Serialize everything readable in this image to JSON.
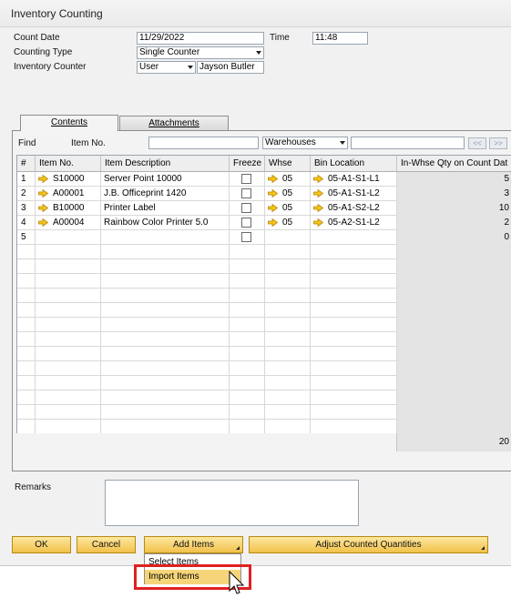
{
  "window": {
    "title": "Inventory Counting"
  },
  "header": {
    "count_date_label": "Count Date",
    "count_date_value": "11/29/2022",
    "time_label": "Time",
    "time_value": "11:48",
    "counting_type_label": "Counting Type",
    "counting_type_value": "Single Counter",
    "inventory_counter_label": "Inventory Counter",
    "inventory_counter_type": "User",
    "inventory_counter_name": "Jayson Butler"
  },
  "tabs": [
    {
      "label": "Contents",
      "active": true
    },
    {
      "label": "Attachments",
      "active": false
    }
  ],
  "find": {
    "label": "Find",
    "item_no_label": "Item No.",
    "item_no_value": "",
    "warehouses_value": "Warehouses",
    "warehouse_input_value": "",
    "prev_label": "<<",
    "next_label": ">>"
  },
  "grid": {
    "columns": [
      "#",
      "Item No.",
      "Item Description",
      "Freeze",
      "Whse",
      "Bin Location",
      "In-Whse Qty on Count Dat"
    ],
    "rows": [
      {
        "num": "1",
        "item_no": "S10000",
        "description": "Server Point 10000",
        "freeze": false,
        "whse": "05",
        "bin": "05-A1-S1-L1",
        "qty": "5"
      },
      {
        "num": "2",
        "item_no": "A00001",
        "description": "J.B. Officeprint 1420",
        "freeze": false,
        "whse": "05",
        "bin": "05-A1-S1-L2",
        "qty": "3"
      },
      {
        "num": "3",
        "item_no": "B10000",
        "description": "Printer Label",
        "freeze": false,
        "whse": "05",
        "bin": "05-A1-S2-L2",
        "qty": "10"
      },
      {
        "num": "4",
        "item_no": "A00004",
        "description": "Rainbow Color Printer 5.0",
        "freeze": false,
        "whse": "05",
        "bin": "05-A2-S1-L2",
        "qty": "2"
      },
      {
        "num": "5",
        "item_no": "",
        "description": "",
        "freeze": false,
        "whse": "",
        "bin": "",
        "qty": "0"
      }
    ],
    "total_qty": "20"
  },
  "remarks": {
    "label": "Remarks",
    "value": ""
  },
  "buttons": {
    "ok": "OK",
    "cancel": "Cancel",
    "add_items": "Add Items",
    "adjust_counted": "Adjust Counted Quantities"
  },
  "add_items_menu": {
    "items": [
      "Select Items",
      "Import Items"
    ],
    "highlighted": "Import Items"
  },
  "colors": {
    "button_fill": "#f2c14a",
    "button_border": "#b88a12",
    "highlight": "#f6d57a",
    "annotation_red": "#e02020",
    "arrow_icon": "#f5c518"
  }
}
